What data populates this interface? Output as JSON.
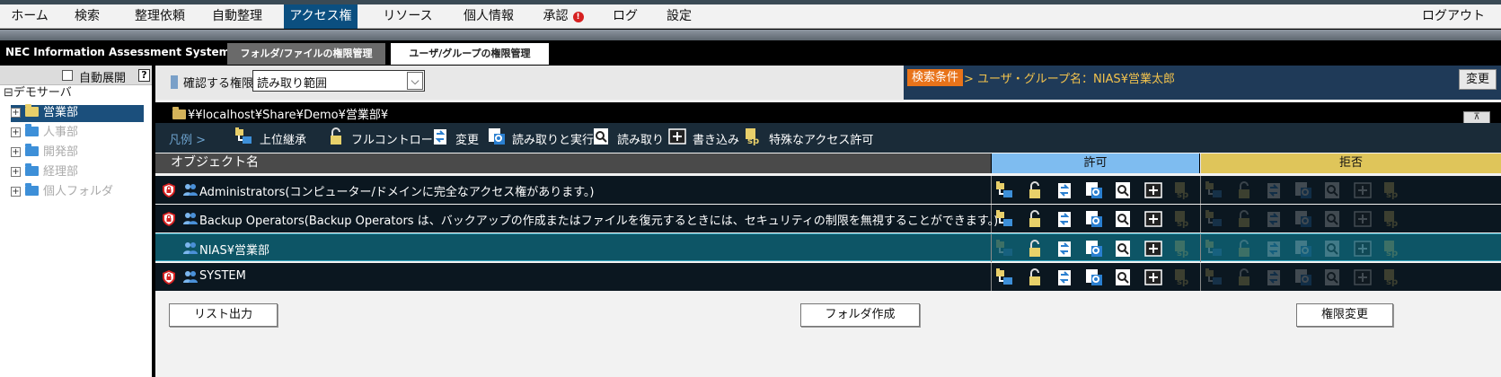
{
  "menu": {
    "items": [
      {
        "label": "ホーム"
      },
      {
        "label": "検索"
      },
      {
        "label": "整理依頼"
      },
      {
        "label": "自動整理"
      },
      {
        "label": "アクセス権"
      },
      {
        "label": "リソース"
      },
      {
        "label": "個人情報"
      },
      {
        "label": "承認"
      },
      {
        "label": "ログ"
      },
      {
        "label": "設定"
      }
    ],
    "active": "アクセス権",
    "approve_badge": "!",
    "logout": "ログアウト"
  },
  "brand": "NEC Information Assessment System",
  "tabs": [
    {
      "label": "フォルダ/ファイルの権限管理",
      "active": true
    },
    {
      "label": "ユーザ/グループの権限管理",
      "active": false
    }
  ],
  "sidebar": {
    "auto_expand_label": "自動展開",
    "auto_expand_checked": false,
    "help": "?",
    "root": {
      "label": "デモサーバ",
      "toggle": "⊟"
    },
    "items": [
      {
        "label": "営業部",
        "selected": true,
        "toggle": "+"
      },
      {
        "label": "人事部",
        "toggle": "+"
      },
      {
        "label": "開発部",
        "toggle": "+"
      },
      {
        "label": "経理部",
        "toggle": "+"
      },
      {
        "label": "個人フォルダ",
        "toggle": "+"
      }
    ]
  },
  "filter": {
    "perm_label": "確認する権限",
    "perm_value": "読み取り範囲",
    "cond_tag": "検索条件",
    "cond_text": "> ユーザ・グループ名：NIAS¥営業太郎",
    "change_button": "変更"
  },
  "path": "¥¥localhost¥Share¥Demo¥営業部¥",
  "collapse_glyph": "⊼",
  "legend": {
    "title": "凡例 >",
    "items": [
      {
        "label": "上位継承",
        "icon": "inherit-icon"
      },
      {
        "label": "フルコントロール",
        "icon": "full-control-icon"
      },
      {
        "label": "変更",
        "icon": "modify-icon"
      },
      {
        "label": "読み取りと実行",
        "icon": "read-execute-icon"
      },
      {
        "label": "読み取り",
        "icon": "read-icon"
      },
      {
        "label": "書き込み",
        "icon": "write-icon"
      },
      {
        "label": "特殊なアクセス許可",
        "icon": "special-icon"
      }
    ]
  },
  "table": {
    "header_name": "オブジェクト名",
    "header_allow": "許可",
    "header_deny": "拒否",
    "rows": [
      {
        "name": "Administrators(コンピューター/ドメインに完全なアクセス権があります。)",
        "shield": true,
        "selected": false,
        "allow": [
          1,
          1,
          1,
          1,
          1,
          1,
          0
        ],
        "deny": [
          0,
          0,
          0,
          0,
          0,
          0,
          0
        ]
      },
      {
        "name": "Backup Operators(Backup Operators は、バックアップの作成またはファイルを復元するときには、セキュリティの制限を無視することができます。)",
        "shield": true,
        "selected": false,
        "allow": [
          1,
          1,
          1,
          1,
          1,
          1,
          0
        ],
        "deny": [
          0,
          0,
          0,
          0,
          0,
          0,
          0
        ]
      },
      {
        "name": "NIAS¥営業部",
        "shield": false,
        "selected": true,
        "allow": [
          0,
          1,
          1,
          1,
          1,
          1,
          0
        ],
        "deny": [
          0,
          0,
          0,
          0,
          0,
          0,
          0
        ]
      },
      {
        "name": "SYSTEM",
        "shield": true,
        "selected": false,
        "allow": [
          1,
          1,
          1,
          1,
          1,
          1,
          0
        ],
        "deny": [
          0,
          0,
          0,
          0,
          0,
          0,
          0
        ]
      }
    ]
  },
  "buttons": {
    "list_export": "リスト出力",
    "create_folder": "フォルダ作成",
    "change_perm": "権限変更"
  },
  "colors": {
    "accent": "#0b4f80",
    "allow_header": "#7ebcf0",
    "deny_header": "#dfc55a",
    "cond_tag": "#e8731a",
    "cond_text": "#f3c34d",
    "selected_row": "#0d5566"
  }
}
